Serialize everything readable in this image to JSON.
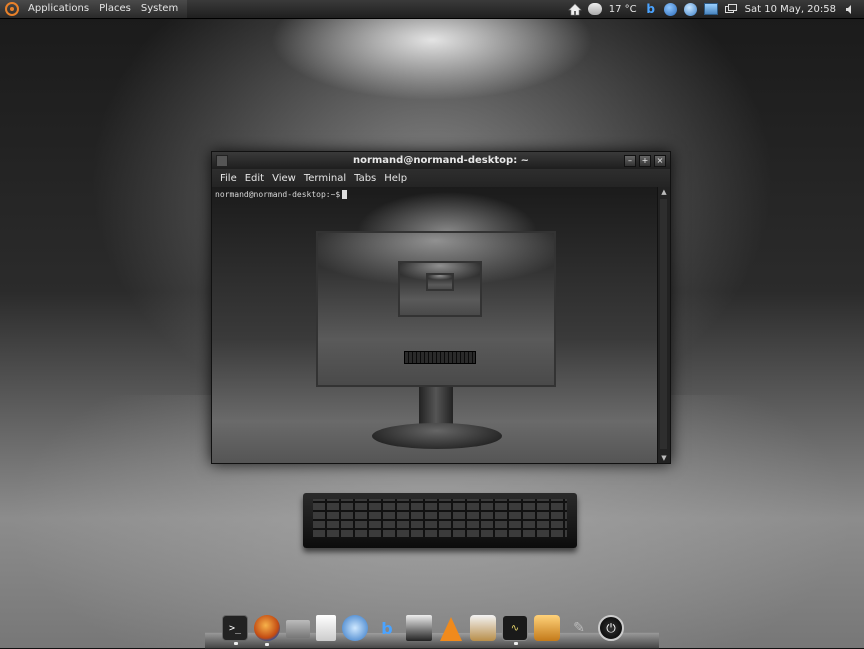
{
  "top_panel": {
    "menus": [
      "Applications",
      "Places",
      "System"
    ],
    "temperature": "17 °C",
    "clock": "Sat 10 May, 20:58"
  },
  "terminal_window": {
    "title": "normand@normand-desktop: ~",
    "menus": [
      "File",
      "Edit",
      "View",
      "Terminal",
      "Tabs",
      "Help"
    ],
    "prompt": "normand@normand-desktop:~$",
    "controls": [
      "–",
      "+",
      "×"
    ]
  },
  "dock": {
    "items": [
      {
        "name": "terminal",
        "glyph": ">_",
        "running": true
      },
      {
        "name": "firefox",
        "glyph": "",
        "running": true
      },
      {
        "name": "mail",
        "glyph": "",
        "running": false
      },
      {
        "name": "documents",
        "glyph": "",
        "running": false
      },
      {
        "name": "web-browser",
        "glyph": "",
        "running": false
      },
      {
        "name": "beep",
        "glyph": "b",
        "running": false
      },
      {
        "name": "media-editor",
        "glyph": "",
        "running": false
      },
      {
        "name": "vlc",
        "glyph": "",
        "running": false
      },
      {
        "name": "package-manager",
        "glyph": "",
        "running": false
      },
      {
        "name": "system-monitor",
        "glyph": "∿",
        "running": true
      },
      {
        "name": "archive",
        "glyph": "",
        "running": false
      },
      {
        "name": "gimp",
        "glyph": "✎",
        "running": false
      },
      {
        "name": "shutdown",
        "glyph": "⏻",
        "running": false
      }
    ]
  },
  "icons": {
    "home": "home-icon",
    "weather": "weather-icon",
    "volume": "volume-icon"
  }
}
